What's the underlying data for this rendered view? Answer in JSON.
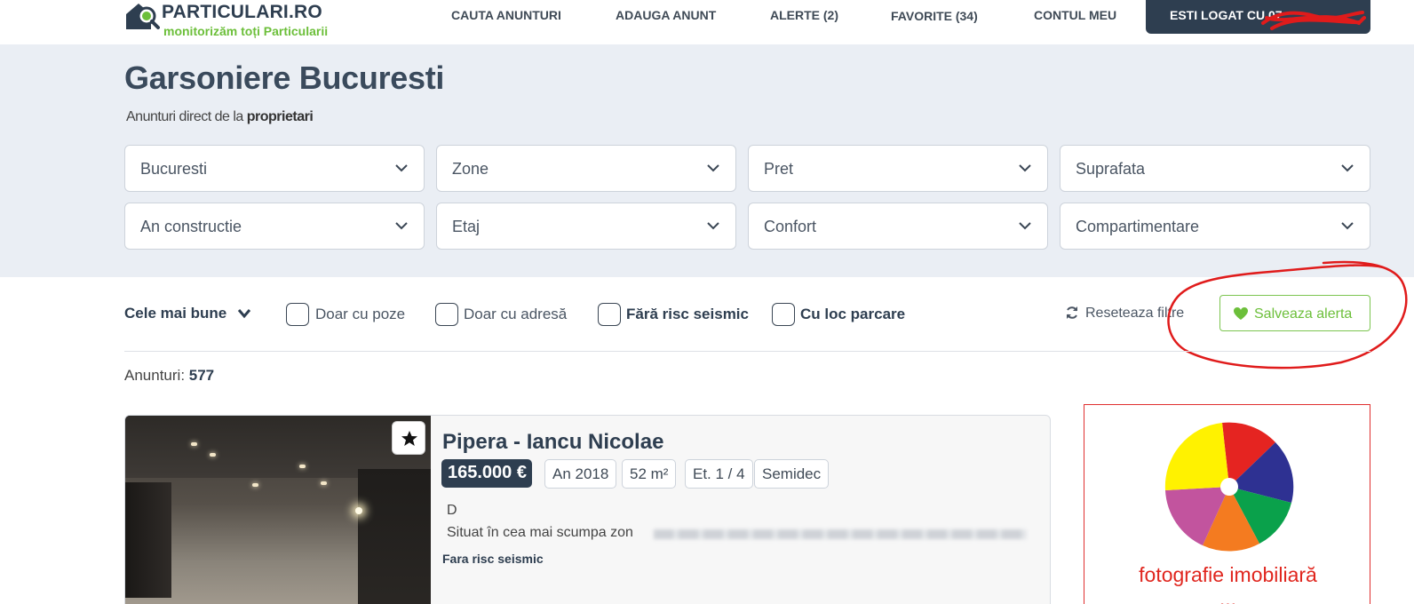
{
  "logo": {
    "name": "PARTICULARI.RO",
    "tagline": "monitorizăm toți Particularii"
  },
  "nav": {
    "items": [
      {
        "label": "CAUTA ANUNTURI"
      },
      {
        "label": "ADAUGA ANUNT"
      },
      {
        "label": "ALERTE (2)"
      },
      {
        "label": "FAVORITE  (34)"
      },
      {
        "label": "CONTUL MEU"
      }
    ],
    "login_label": "ESTI LOGAT CU 07"
  },
  "hero": {
    "title": "Garsoniere Bucuresti",
    "subtitle_prefix": "Anunturi direct de la ",
    "subtitle_bold": "proprietari"
  },
  "filters": [
    {
      "label": "Bucuresti"
    },
    {
      "label": "Zone"
    },
    {
      "label": "Pret"
    },
    {
      "label": "Suprafata"
    },
    {
      "label": "An constructie"
    },
    {
      "label": "Etaj"
    },
    {
      "label": "Confort"
    },
    {
      "label": "Compartimentare"
    }
  ],
  "toolbar": {
    "sort_label": "Cele mai bune",
    "checkboxes": [
      {
        "label": "Doar cu poze",
        "checked": false
      },
      {
        "label": "Doar cu adresă",
        "checked": false
      },
      {
        "label": "Fără risc seismic",
        "checked": false
      },
      {
        "label": "Cu loc parcare",
        "checked": false
      }
    ],
    "reset_label": "Reseteaza filtre",
    "save_alert_label": "Salveaza alerta"
  },
  "results": {
    "count_label": "Anunturi: ",
    "count": "577"
  },
  "listing": {
    "title": "Pipera - Iancu Nicolae",
    "price": "165.000 €",
    "tags": [
      "An 2018",
      "52 m²",
      "Et. 1 / 4",
      "Semidec"
    ],
    "desc_line1": "D",
    "desc_line2": "Situat în cea mai scumpa zon",
    "badge": "Fara risc seismic"
  },
  "ad": {
    "line1": "fotografie imobiliară",
    "line2": "..."
  },
  "colors": {
    "navy": "#2e3e50",
    "green": "#6cbf3a",
    "hero_bg": "#eaeef4",
    "annotation_red": "#e01b1b"
  }
}
